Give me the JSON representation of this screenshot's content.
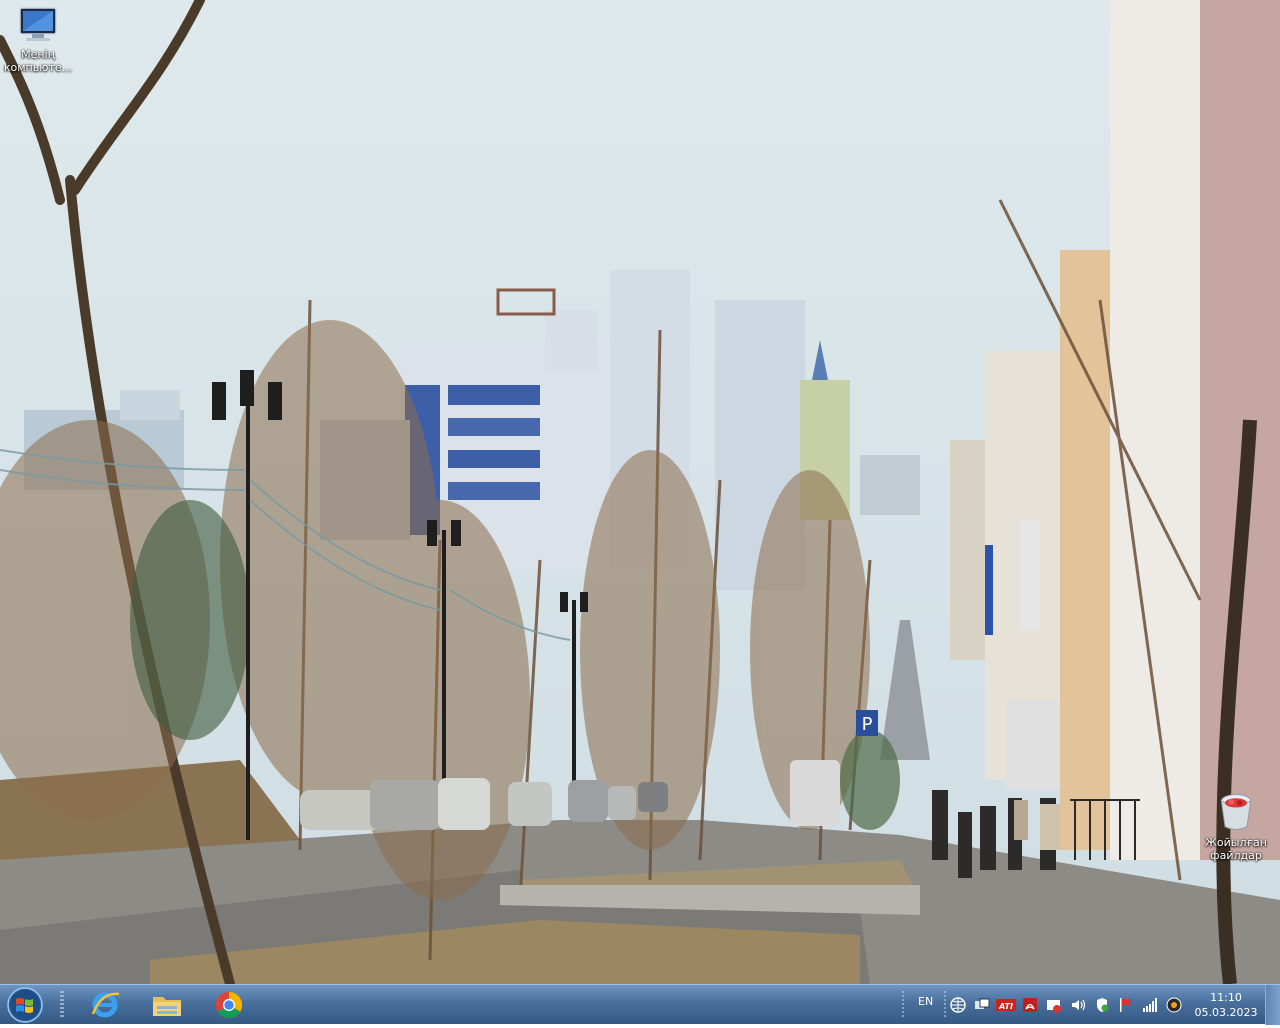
{
  "desktop": {
    "icons": [
      {
        "label": "Менің компьюте...",
        "icon": "monitor-icon"
      },
      {
        "label": "Жойылған файлдар",
        "icon": "recycle-bin-icon"
      }
    ]
  },
  "taskbar": {
    "start_icon": "windows-logo-icon",
    "pinned": [
      {
        "name": "internet-explorer",
        "icon": "ie-icon"
      },
      {
        "name": "file-explorer",
        "icon": "folder-icon"
      },
      {
        "name": "google-chrome",
        "icon": "chrome-icon"
      }
    ],
    "tray": {
      "language": "EN",
      "icons": [
        "network-globe-icon",
        "remote-icon",
        "ati-icon",
        "acrobat-icon",
        "notification-icon",
        "volume-icon",
        "security-icon",
        "flag-icon",
        "signal-icon",
        "power-icon"
      ],
      "ati_label": "ATI"
    },
    "clock": {
      "time": "11:10",
      "date": "05.03.2023"
    }
  },
  "colors": {
    "taskbar": "#4a6f9c",
    "accent": "#355983"
  }
}
